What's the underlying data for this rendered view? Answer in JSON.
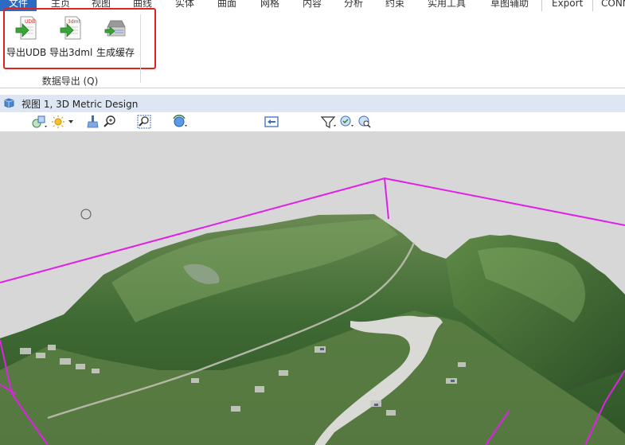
{
  "menu": {
    "tabs": [
      "文件",
      "主页",
      "视图",
      "曲线",
      "实体",
      "曲面",
      "网格",
      "内容",
      "分析",
      "约束",
      "实用工具",
      "草图辅助",
      "Export",
      "CONN"
    ]
  },
  "ribbon": {
    "buttons": [
      {
        "label": "导出UDB",
        "icon": "export-udb-icon",
        "badge": "UDB"
      },
      {
        "label": "导出3dml",
        "icon": "export-3dml-icon",
        "badge": "3dml"
      },
      {
        "label": "生成缓存",
        "icon": "generate-cache-icon"
      }
    ],
    "group_label": "数据导出 (Q)"
  },
  "view": {
    "title": "视图 1, 3D Metric Design",
    "toolbar_icons": [
      "shapes-dropdown-icon",
      "sun-dropdown-icon",
      "brush-icon",
      "zoom-in-icon",
      "zoom-window-icon",
      "rotate-globe-icon",
      "fit-view-icon",
      "filter-funnel-icon",
      "globe-check-icon",
      "globe-search-icon"
    ]
  },
  "colors": {
    "accent": "#2b6bc4",
    "highlight": "#e0231e",
    "bounding_box": "#e020e8",
    "title_bar": "#dde6f2"
  }
}
